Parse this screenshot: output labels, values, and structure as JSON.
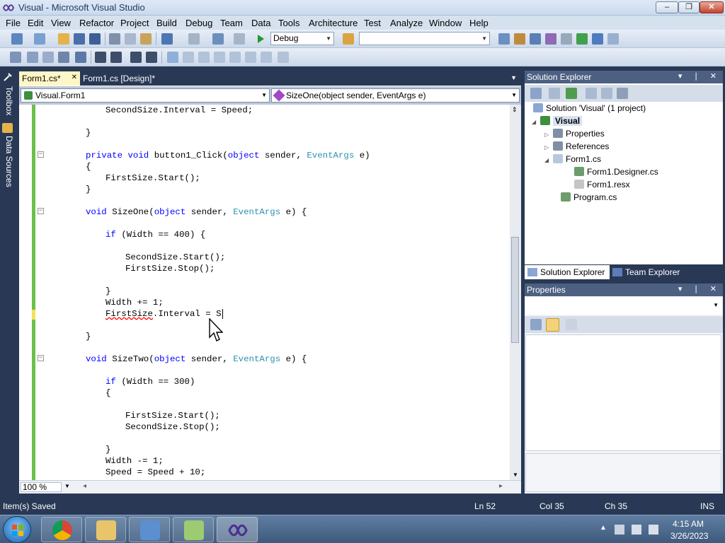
{
  "window": {
    "title": "Visual - Microsoft Visual Studio",
    "min_label": "–",
    "max_label": "❐",
    "close_label": "✕"
  },
  "menu": [
    "File",
    "Edit",
    "View",
    "Refactor",
    "Project",
    "Build",
    "Debug",
    "Team",
    "Data",
    "Tools",
    "Architecture",
    "Test",
    "Analyze",
    "Window",
    "Help"
  ],
  "toolbar": {
    "config": "Debug",
    "platform": ""
  },
  "left_strip": {
    "toolbox": "Toolbox",
    "datasources": "Data Sources"
  },
  "editor": {
    "tabs": [
      "Form1.cs*",
      "Form1.cs [Design]*"
    ],
    "class_combo": "Visual.Form1",
    "member_combo": "SizeOne(object sender, EventArgs e)",
    "zoom": "100 %"
  },
  "code": {
    "l1": "SecondSize.Interval = Speed;",
    "l2": "}",
    "l3_kw1": "private",
    "l3_kw2": "void",
    "l3_a": "button1_Click(",
    "l3_kw3": "object",
    "l3_b": "sender,",
    "l3_ty": "EventArgs",
    "l3_c": "e)",
    "l4": "{",
    "l5": "FirstSize.Start();",
    "l6": "}",
    "l7_kw1": "void",
    "l7_a": "SizeOne(",
    "l7_kw2": "object",
    "l7_b": "sender,",
    "l7_ty": "EventArgs",
    "l7_c": "e) {",
    "l8_kw": "if",
    "l8_a": "(Width == 400) {",
    "l9": "SecondSize.Start();",
    "l10": "FirstSize.Stop();",
    "l11": "}",
    "l12": "Width += 1;",
    "l13_sq": "FirstSize",
    "l13_a": ".Interval = S",
    "l14": "}",
    "l15_kw1": "void",
    "l15_a": "SizeTwo(",
    "l15_kw2": "object",
    "l15_b": "sender,",
    "l15_ty": "EventArgs",
    "l15_c": "e) {",
    "l16_kw": "if",
    "l16_a": "(Width == 300)",
    "l17": "{",
    "l18": "FirstSize.Start();",
    "l19": "SecondSize.Stop();",
    "l20": "}",
    "l21": "Width -= 1;",
    "l22": "Speed = Speed + 10;"
  },
  "solution_explorer": {
    "title": "Solution Explorer",
    "ctrl_labels": "▾ ❘ ✕",
    "tree": {
      "solution": "Solution 'Visual' (1 project)",
      "project": "Visual",
      "properties": "Properties",
      "references": "References",
      "form1": "Form1.cs",
      "designer": "Form1.Designer.cs",
      "resx": "Form1.resx",
      "program": "Program.cs"
    },
    "tabs": [
      "Solution Explorer",
      "Team Explorer"
    ]
  },
  "properties_panel": {
    "title": "Properties",
    "ctrl_labels": "▾ ❘ ✕"
  },
  "status": {
    "message": "Item(s) Saved",
    "ln": "Ln 52",
    "col": "Col 35",
    "ch": "Ch 35",
    "mode": "INS"
  },
  "clock": {
    "time": "4:15 AM",
    "date": "3/26/2023"
  },
  "colors": {
    "keyword": "#0000ff",
    "type": "#2b91af",
    "vs_dark": "#293955"
  }
}
